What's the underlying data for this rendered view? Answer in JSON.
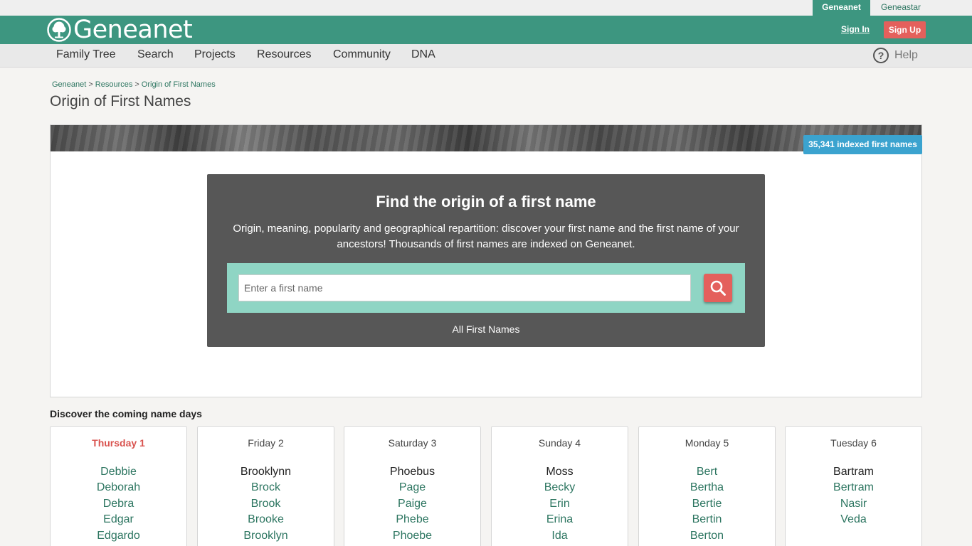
{
  "site_tabs": {
    "active": "Geneanet",
    "other": "Geneastar"
  },
  "header": {
    "logo_text": "Geneanet",
    "sign_in": "Sign In",
    "sign_up": "Sign Up"
  },
  "nav": {
    "items": [
      "Family Tree",
      "Search",
      "Projects",
      "Resources",
      "Community",
      "DNA"
    ],
    "help": "Help"
  },
  "breadcrumb": [
    "Geneanet",
    "Resources",
    "Origin of First Names"
  ],
  "page_title": "Origin of First Names",
  "badge": "35,341 indexed first names",
  "search": {
    "title": "Find the origin of a first name",
    "description": "Origin, meaning, popularity and geographical repartition: discover your first name and the first name of your ancestors! Thousands of first names are indexed on Geneanet.",
    "placeholder": "Enter a first name",
    "all_link": "All First Names"
  },
  "name_days": {
    "title": "Discover the coming name days",
    "days": [
      {
        "label": "Thursday 1",
        "today": true,
        "names": [
          {
            "n": "Debbie",
            "link": true
          },
          {
            "n": "Deborah",
            "link": true
          },
          {
            "n": "Debra",
            "link": true
          },
          {
            "n": "Edgar",
            "link": true
          },
          {
            "n": "Edgardo",
            "link": true
          }
        ]
      },
      {
        "label": "Friday 2",
        "names": [
          {
            "n": "Brooklynn",
            "link": false
          },
          {
            "n": "Brock",
            "link": true
          },
          {
            "n": "Brook",
            "link": true
          },
          {
            "n": "Brooke",
            "link": true
          },
          {
            "n": "Brooklyn",
            "link": true
          }
        ]
      },
      {
        "label": "Saturday 3",
        "names": [
          {
            "n": "Phoebus",
            "link": false
          },
          {
            "n": "Page",
            "link": true
          },
          {
            "n": "Paige",
            "link": true
          },
          {
            "n": "Phebe",
            "link": true
          },
          {
            "n": "Phoebe",
            "link": true
          }
        ]
      },
      {
        "label": "Sunday 4",
        "names": [
          {
            "n": "Moss",
            "link": false
          },
          {
            "n": "Becky",
            "link": true
          },
          {
            "n": "Erin",
            "link": true
          },
          {
            "n": "Erina",
            "link": true
          },
          {
            "n": "Ida",
            "link": true
          }
        ]
      },
      {
        "label": "Monday 5",
        "names": [
          {
            "n": "Bert",
            "link": true
          },
          {
            "n": "Bertha",
            "link": true
          },
          {
            "n": "Bertie",
            "link": true
          },
          {
            "n": "Bertin",
            "link": true
          },
          {
            "n": "Berton",
            "link": true
          }
        ]
      },
      {
        "label": "Tuesday 6",
        "names": [
          {
            "n": "Bartram",
            "link": false
          },
          {
            "n": "Bertram",
            "link": true
          },
          {
            "n": "Nasir",
            "link": true
          },
          {
            "n": "Veda",
            "link": true
          }
        ]
      }
    ]
  },
  "icons": {
    "logo": "tree-icon",
    "search": "search-icon",
    "help": "question-icon"
  },
  "colors": {
    "brand_green": "#3d9680",
    "accent_red": "#e4605c",
    "badge_blue": "#3ba3cf",
    "search_bar": "#8fd5c4",
    "search_panel": "#575757"
  }
}
